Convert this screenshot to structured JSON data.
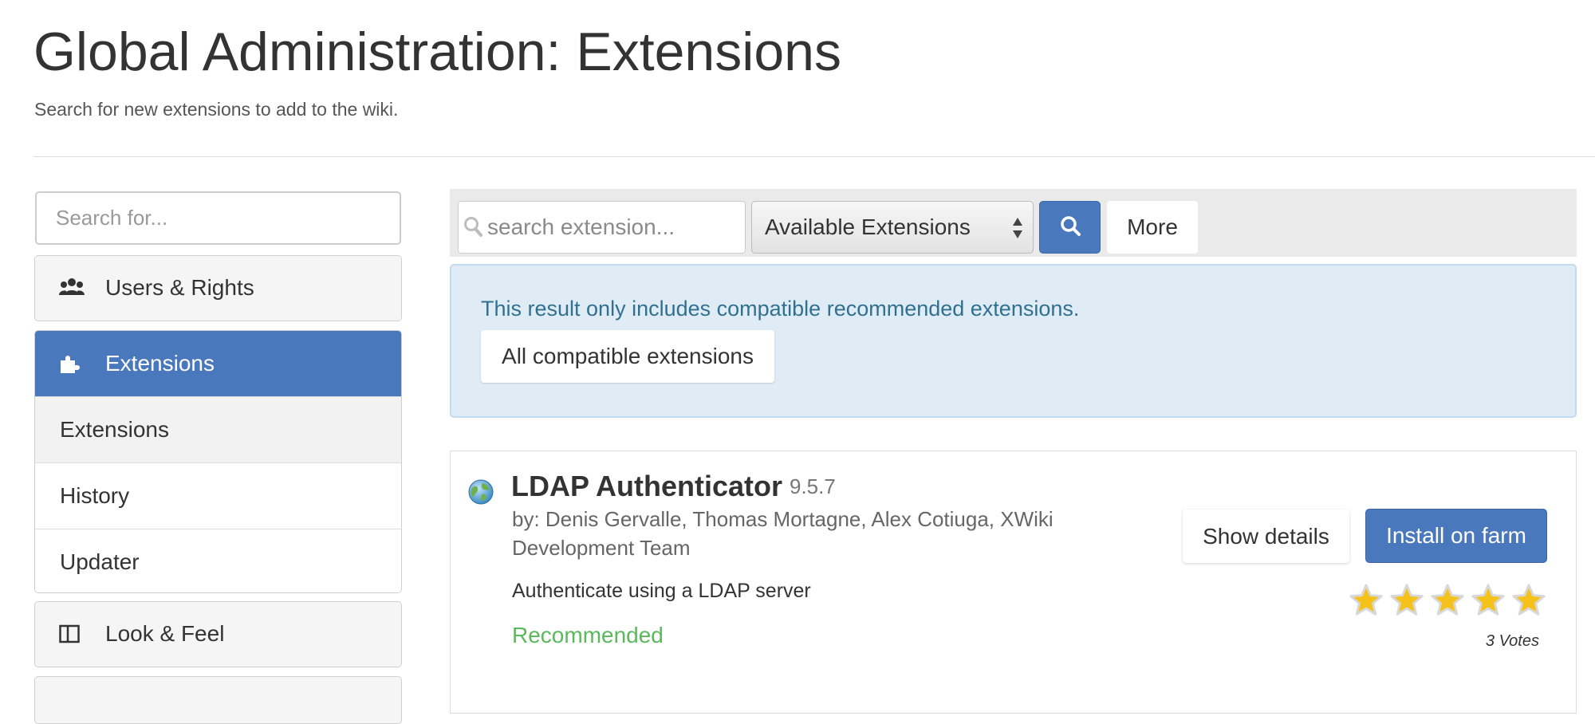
{
  "header": {
    "title": "Global Administration: Extensions",
    "subtitle": "Search for new extensions to add to the wiki."
  },
  "sidebar": {
    "search_placeholder": "Search for...",
    "sections": [
      {
        "label": "Users & Rights",
        "icon": "users-icon"
      },
      {
        "label": "Extensions",
        "icon": "puzzle-icon",
        "active": true,
        "items": [
          {
            "label": "Extensions",
            "active": true
          },
          {
            "label": "History"
          },
          {
            "label": "Updater"
          }
        ]
      },
      {
        "label": "Look & Feel",
        "icon": "layout-icon"
      }
    ]
  },
  "toolbar": {
    "search_placeholder": "search extension...",
    "filter_selected": "Available Extensions",
    "search_button_icon": "search-icon",
    "more_label": "More"
  },
  "info": {
    "message": "This result only includes compatible recommended extensions.",
    "button_label": "All compatible extensions"
  },
  "extension": {
    "name": "LDAP Authenticator",
    "version": "9.5.7",
    "authors": "by: Denis Gervalle, Thomas Mortagne, Alex Cotiuga, XWiki Development Team",
    "description": "Authenticate using a LDAP server",
    "status": "Recommended",
    "show_details_label": "Show details",
    "install_label": "Install on farm",
    "rating_stars": 5,
    "votes": "3 Votes",
    "icon": "globe-icon"
  },
  "colors": {
    "primary": "#4a78bd",
    "info_bg": "#dfecf6",
    "info_text": "#31708f",
    "recommended": "#5cb85c"
  }
}
